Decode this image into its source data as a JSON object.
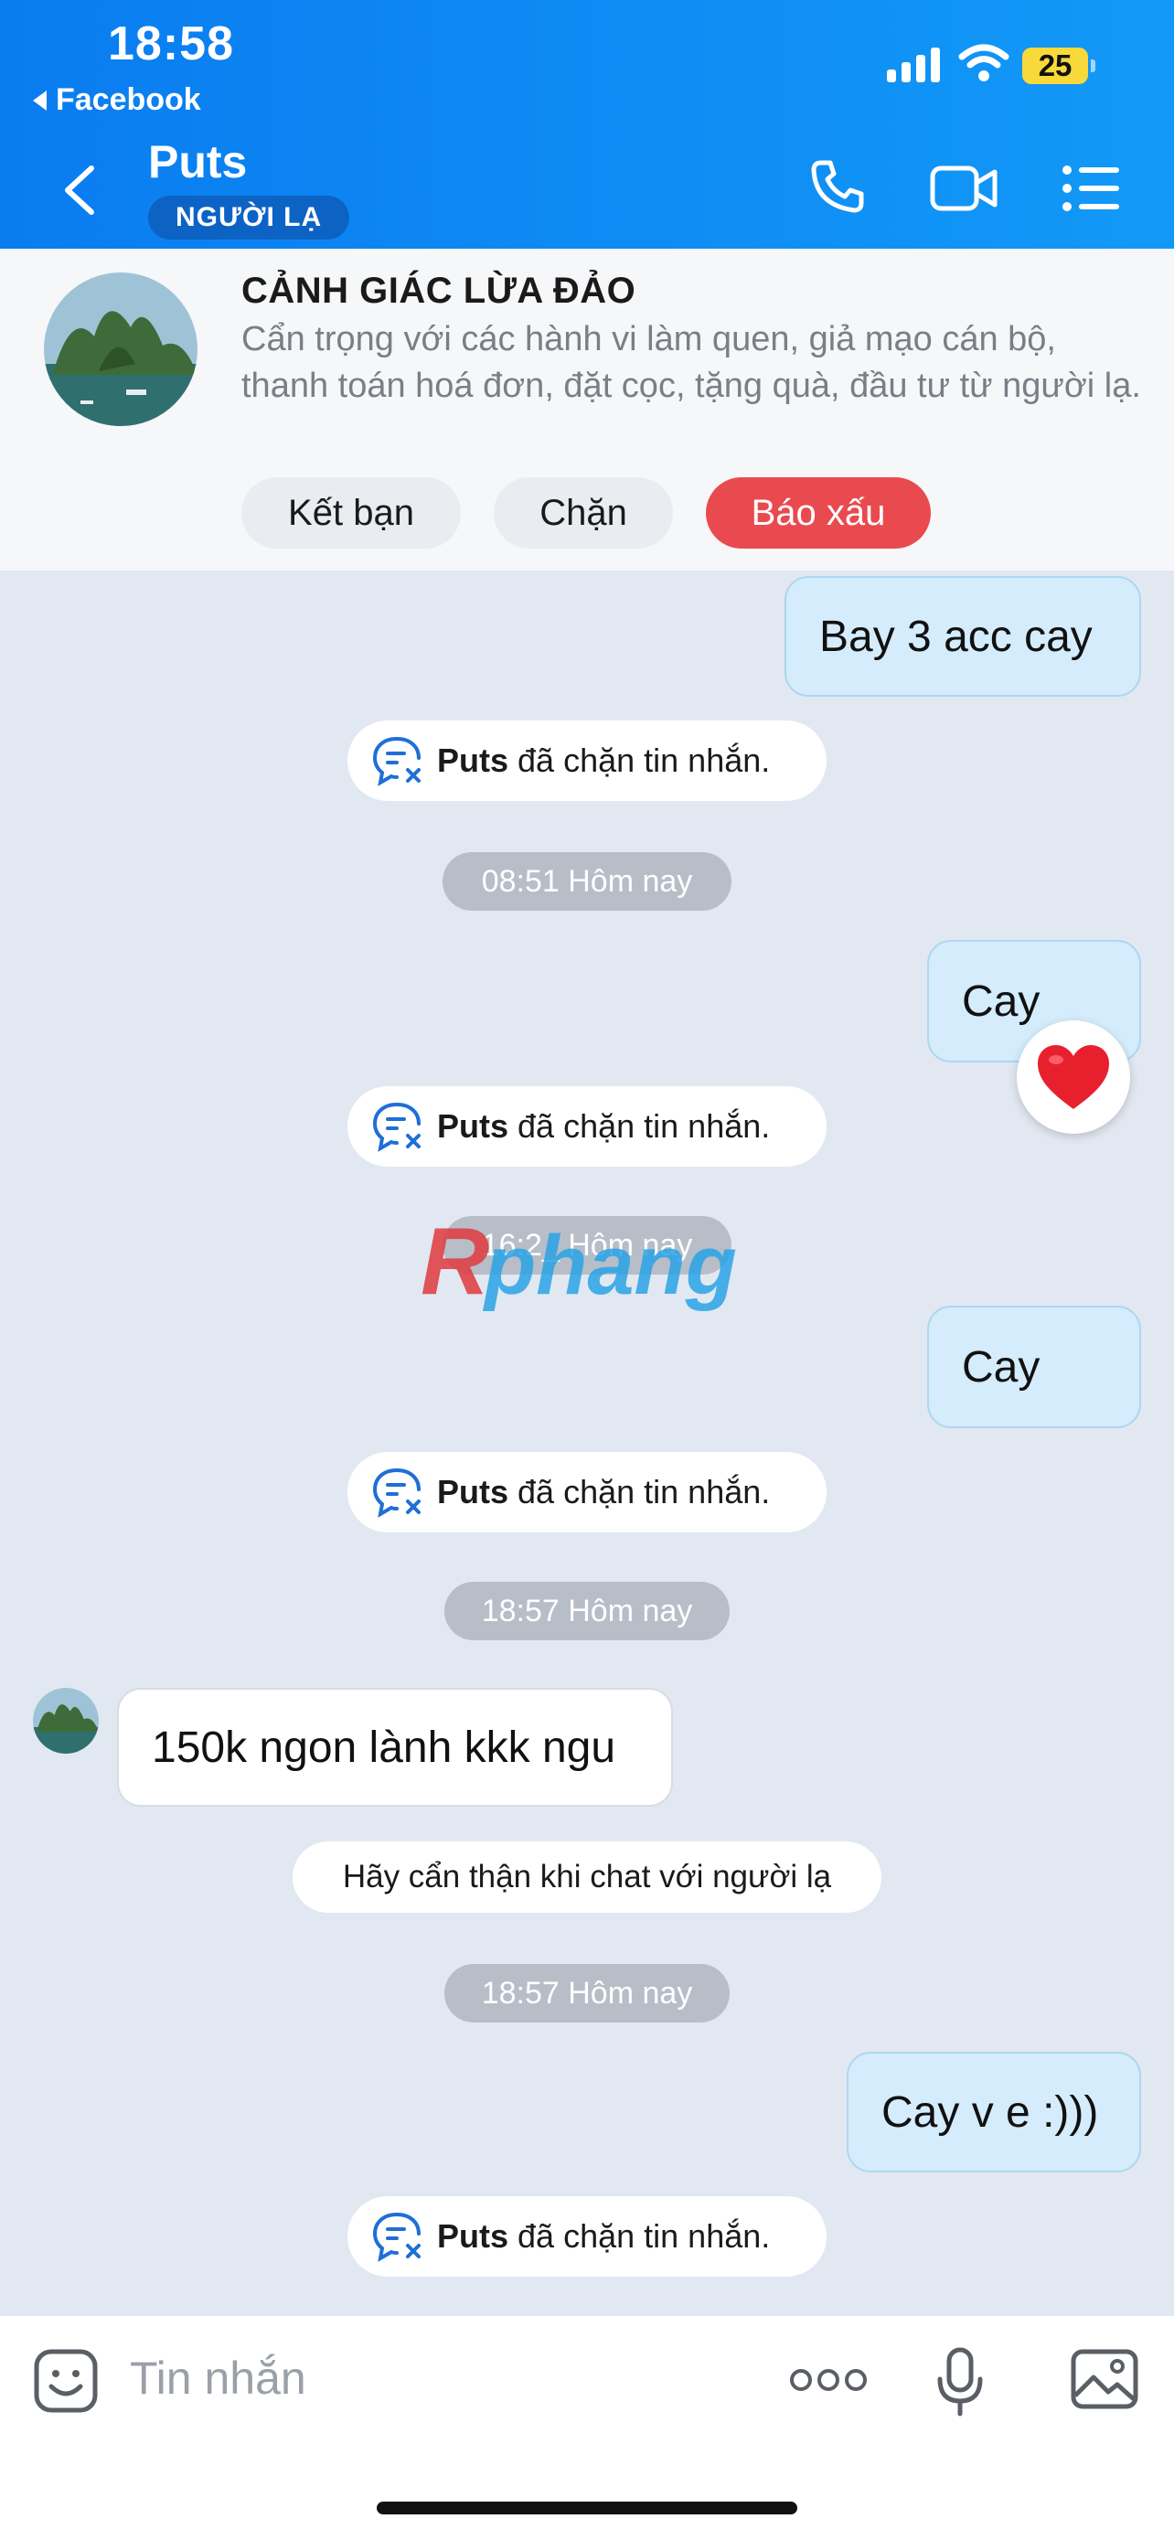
{
  "status_bar": {
    "time": "18:58",
    "back_app": "Facebook",
    "battery": "25"
  },
  "header": {
    "contact_name": "Puts",
    "badge": "NGƯỜI LẠ"
  },
  "banner": {
    "title": "CẢNH GIÁC LỪA ĐẢO",
    "text": "Cẩn trọng với các hành vi làm quen, giả mạo cán bộ, thanh toán hoá đơn, đặt cọc, tặng quà, đầu tư từ người lạ.",
    "buttons": {
      "add_friend": "Kết bạn",
      "block": "Chặn",
      "report": "Báo xấu"
    }
  },
  "messages": {
    "m1": "Bay 3 acc cay",
    "blocked_name": "Puts",
    "blocked_suffix": "đã chặn tin nhắn.",
    "time1": "08:51 Hôm nay",
    "m2": "Cay",
    "time2": "16:2_ Hôm nay",
    "m3": "Cay",
    "time3": "18:57 Hôm nay",
    "m4": "150k ngon lành kkk ngu",
    "tip": "Hãy cẩn thận khi chat với người lạ",
    "time4": "18:57 Hôm nay",
    "m5": "Cay v e :)))"
  },
  "watermark": "Rphang",
  "input": {
    "placeholder": "Tin nhắn"
  },
  "colors": {
    "header": "#0a7cf0",
    "report": "#e94a4f",
    "outgoing": "#d4ecfb",
    "chat_bg": "#e2e8f1"
  }
}
